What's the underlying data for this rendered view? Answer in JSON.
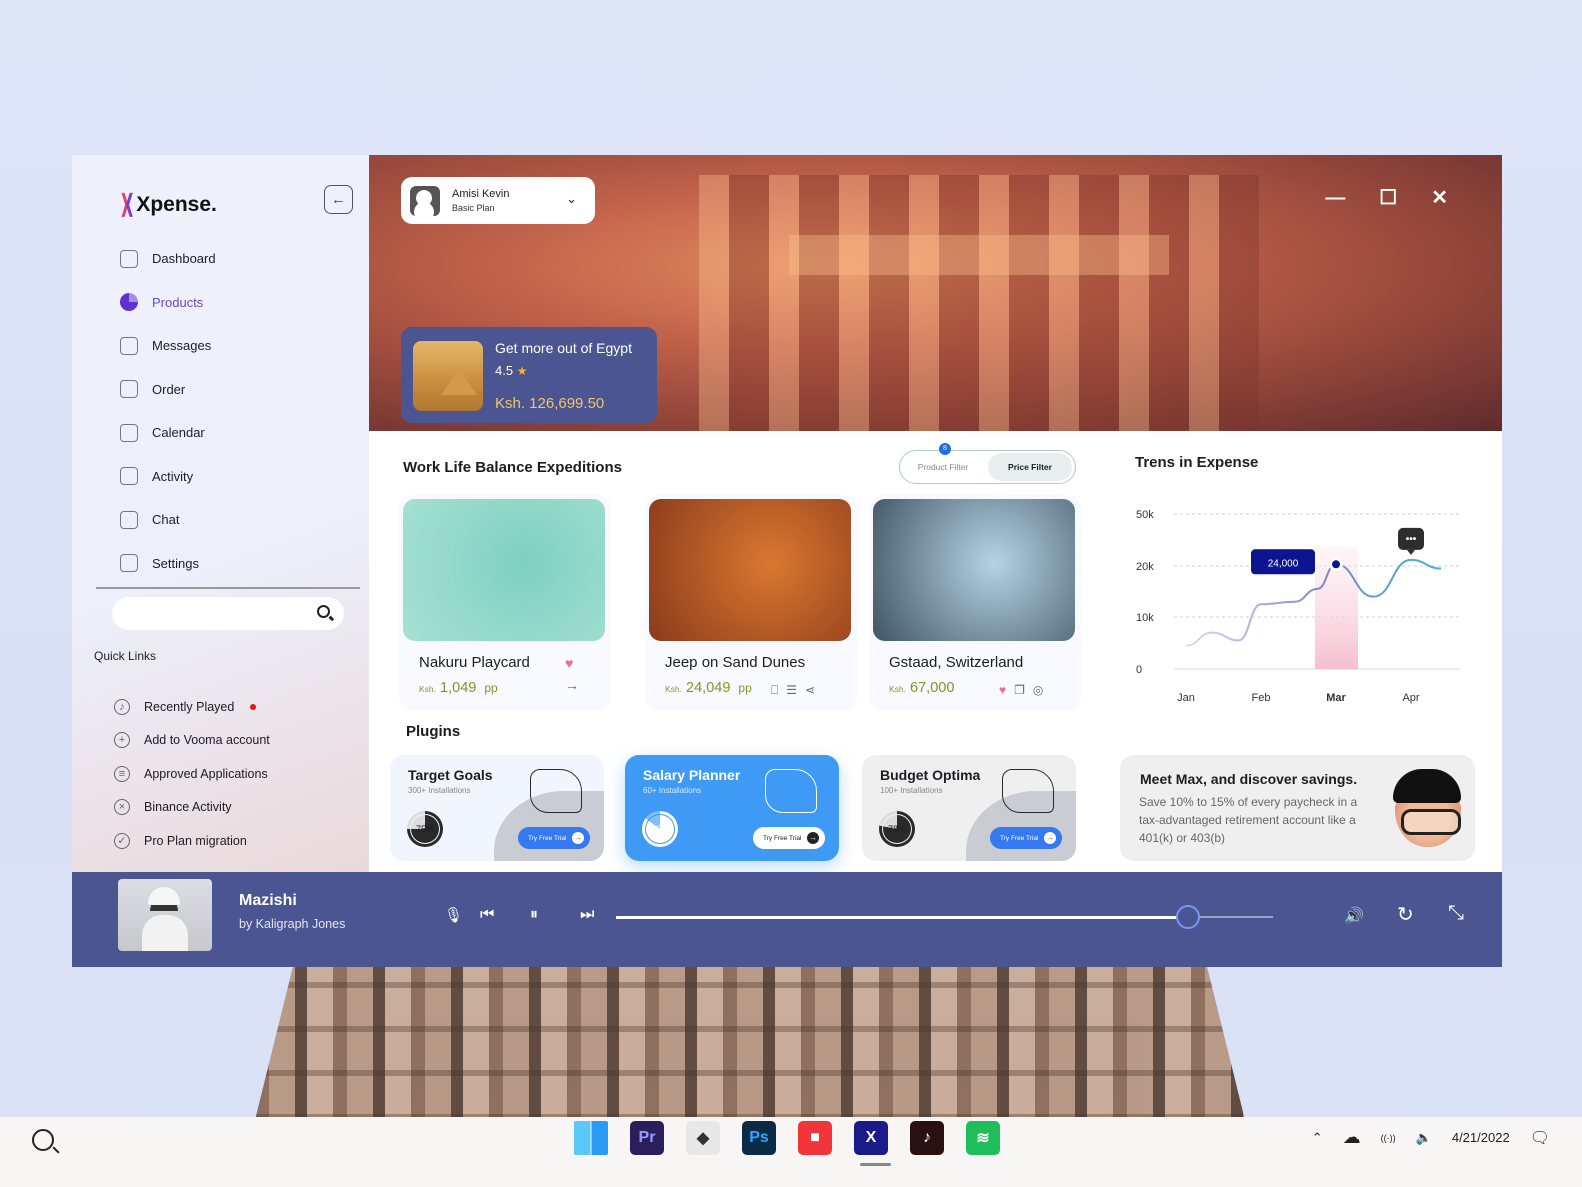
{
  "app": {
    "name": "Xpense.",
    "back_label": "←"
  },
  "sidebar": {
    "nav": [
      {
        "label": "Dashboard",
        "icon": "grid-icon",
        "active": false
      },
      {
        "label": "Products",
        "icon": "pie-chart-icon",
        "active": true
      },
      {
        "label": "Messages",
        "icon": "mail-icon",
        "active": false
      },
      {
        "label": "Order",
        "icon": "bag-icon",
        "active": false
      },
      {
        "label": "Calendar",
        "icon": "calendar-icon",
        "active": false
      },
      {
        "label": "Activity",
        "icon": "activity-icon",
        "active": false
      },
      {
        "label": "Chat",
        "icon": "chat-icon",
        "active": false
      },
      {
        "label": "Settings",
        "icon": "settings-icon",
        "active": false
      }
    ],
    "search": {
      "placeholder": "",
      "value": ""
    },
    "quick_links_title": "Quick Links",
    "quick_links": [
      {
        "label": "Recently Played",
        "icon": "music-note-icon",
        "glyph": "♪",
        "notification": true
      },
      {
        "label": "Add to Vooma account",
        "icon": "plus-circle-icon",
        "glyph": "+",
        "notification": false
      },
      {
        "label": "Approved Applications",
        "icon": "document-icon",
        "glyph": "≡",
        "notification": false
      },
      {
        "label": "Binance Activity",
        "icon": "folder-x-icon",
        "glyph": "×",
        "notification": false
      },
      {
        "label": "Pro Plan migration",
        "icon": "shield-check-icon",
        "glyph": "✓",
        "notification": false
      }
    ]
  },
  "user": {
    "name": "Amisi Kevin",
    "plan": "Basic Plan",
    "chevron": "⌄"
  },
  "window_controls": {
    "minimize": "—",
    "maximize": "☐",
    "close": "✕"
  },
  "promo": {
    "title": "Get more out of Egypt",
    "rating": "4.5",
    "star": "★",
    "price": "Ksh. 126,699.50"
  },
  "expeditions": {
    "title": "Work Life Balance Expeditions",
    "filters": {
      "product": "Product Filter",
      "price": "Price Filter",
      "badge": "8"
    },
    "cards": [
      {
        "name": "Nakuru Playcard",
        "currency": "Ksh.",
        "price": "1,049",
        "unit": "pp",
        "actions": [
          "♥",
          "→"
        ],
        "colors": [
          "#7fd0c0",
          "#a7e1d4"
        ]
      },
      {
        "name": "Jeep on Sand Dunes",
        "currency": "Ksh.",
        "price": "24,049",
        "unit": "pp",
        "actions": [
          "⎕",
          "☰",
          "⋖"
        ],
        "colors": [
          "#d9782f",
          "#8a3a1c"
        ]
      },
      {
        "name": "Gstaad, Switzerland",
        "currency": "Ksh.",
        "price": "67,000",
        "unit": "",
        "actions": [
          "♥",
          "❐",
          "◎"
        ],
        "colors": [
          "#b6d3e3",
          "#3e5563"
        ]
      }
    ]
  },
  "chart_data": {
    "type": "line",
    "title": "Trens in Expense",
    "categories": [
      "Jan",
      "Feb",
      "Mar",
      "Apr"
    ],
    "y_ticks": [
      "0",
      "10k",
      "20k",
      "50k"
    ],
    "series": [
      {
        "name": "Expense",
        "points": [
          [
            0,
            4500
          ],
          [
            0.35,
            7000
          ],
          [
            0.7,
            5500
          ],
          [
            1,
            12500
          ],
          [
            1.45,
            13000
          ],
          [
            1.75,
            15500
          ],
          [
            2,
            21000
          ],
          [
            2.5,
            14000
          ],
          [
            3,
            23500
          ],
          [
            3.4,
            19500
          ]
        ]
      }
    ],
    "highlight": {
      "category": "Mar",
      "label": "24,000"
    },
    "annotation": "•••",
    "grid": true
  },
  "plugins": {
    "title": "Plugins",
    "items": [
      {
        "name": "Target Goals",
        "installs": "300+ Installations",
        "progress": 75,
        "progress_label": "75%",
        "button": "Try Free Trial",
        "theme": "light"
      },
      {
        "name": "Salary Planner",
        "installs": "60+ Installations",
        "progress": 85,
        "progress_label": "85%",
        "button": "Try Free Trial",
        "theme": "blue"
      },
      {
        "name": "Budget Optima",
        "installs": "100+ Installations",
        "progress": 78,
        "progress_label": "78%",
        "button": "Try Free Trial",
        "theme": "grey"
      }
    ],
    "promo": {
      "title": "Meet Max, and discover savings.",
      "text": "Save 10% to 15% of every paycheck in a tax-advantaged retirement account like a 401(k) or 403(b)"
    }
  },
  "player": {
    "song": "Mazishi",
    "artist": "by Kaligraph Jones",
    "progress": 0.87,
    "controls": {
      "mic": "🎙",
      "prev": "⏮",
      "pause": "⏸",
      "next": "⏭",
      "volume": "🔊",
      "repeat": "↻",
      "expand": "⤡"
    }
  },
  "taskbar": {
    "apps": [
      {
        "name": "windows",
        "label": "",
        "bg": "#3aa5f5",
        "fg": "#fff"
      },
      {
        "name": "premiere",
        "label": "Pr",
        "bg": "#2a1e5c",
        "fg": "#9b9bff"
      },
      {
        "name": "ethereum",
        "label": "◆",
        "bg": "#e8e8e8",
        "fg": "#333"
      },
      {
        "name": "photoshop",
        "label": "Ps",
        "bg": "#0b2a45",
        "fg": "#31a8ff"
      },
      {
        "name": "video",
        "label": "■",
        "bg": "#f0363b",
        "fg": "#fff"
      },
      {
        "name": "xpense",
        "label": "X",
        "bg": "#1a1a8a",
        "fg": "#fff"
      },
      {
        "name": "tiktok",
        "label": "♪",
        "bg": "#2b1010",
        "fg": "#fff"
      },
      {
        "name": "spotify",
        "label": "≋",
        "bg": "#1ebe5d",
        "fg": "#fff"
      }
    ],
    "tray": {
      "chevron": "⌃",
      "cloud": "☁",
      "wifi": "((·))",
      "volume": "🔈",
      "date": "4/21/2022",
      "notification": "🗨"
    }
  }
}
